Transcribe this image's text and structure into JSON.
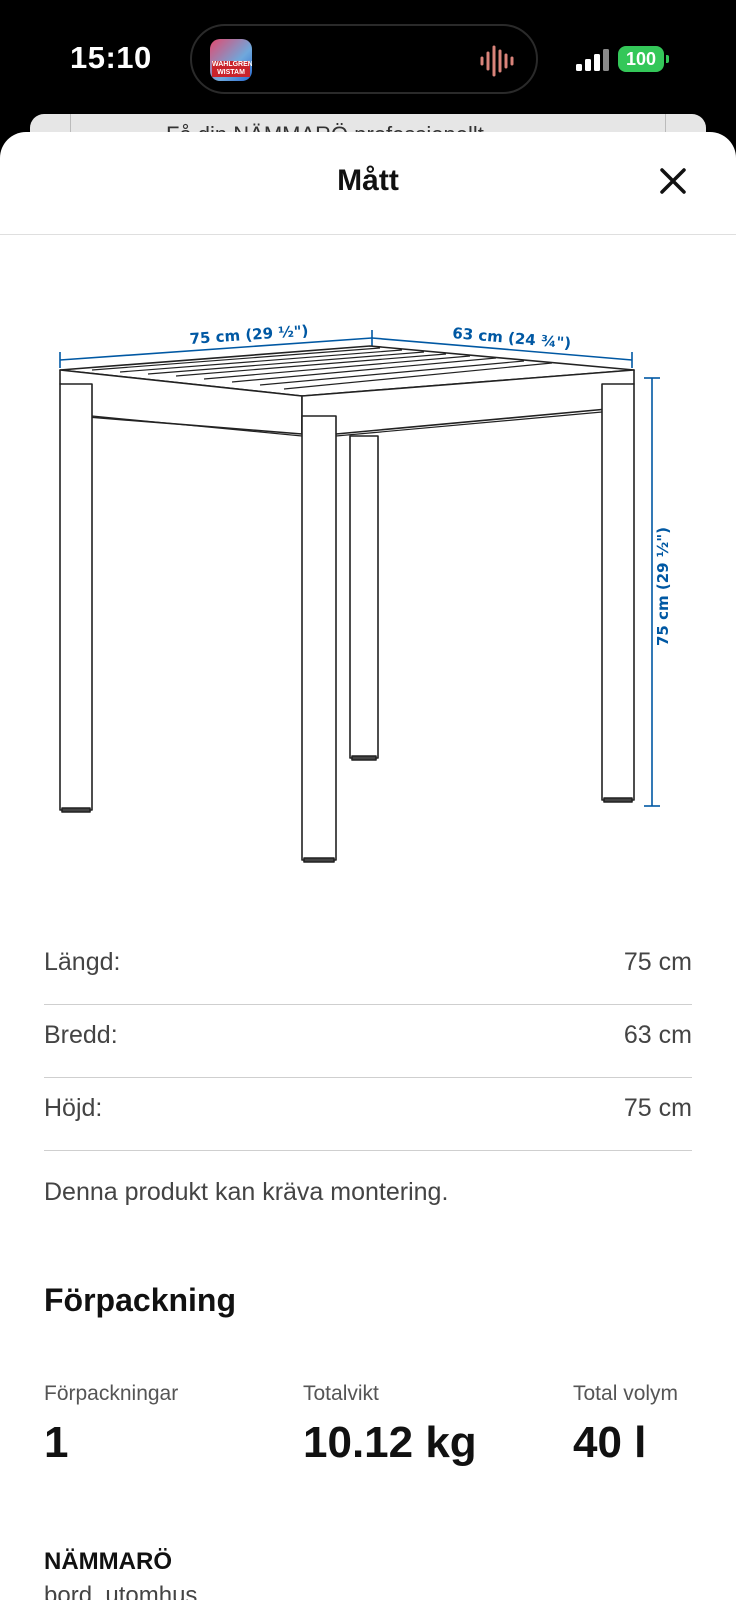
{
  "status_bar": {
    "time": "15:10",
    "island_app_label": "WAHLGREN WISTAM",
    "battery": "100"
  },
  "background_card": {
    "text": "Få din NÄMMARÖ professionellt"
  },
  "sheet": {
    "title": "Mått",
    "close_icon": "close-icon"
  },
  "illustration": {
    "width_label": "75 cm (29 ½\")",
    "depth_label": "63 cm (24 ¾\")",
    "height_label": "75 cm (29 ½\")",
    "accent_color": "#0058a3"
  },
  "dimensions": [
    {
      "label": "Längd:",
      "value": "75 cm"
    },
    {
      "label": "Bredd:",
      "value": "63 cm"
    },
    {
      "label": "Höjd:",
      "value": "75 cm"
    }
  ],
  "assembly_note": "Denna produkt kan kräva montering.",
  "packaging": {
    "heading": "Förpackning",
    "items": [
      {
        "label": "Förpackningar",
        "value": "1"
      },
      {
        "label": "Totalvikt",
        "value": "10.12 kg"
      },
      {
        "label": "Total volym",
        "value": "40 l"
      }
    ]
  },
  "product": {
    "name": "NÄMMARÖ",
    "type": "bord, utomhus"
  }
}
